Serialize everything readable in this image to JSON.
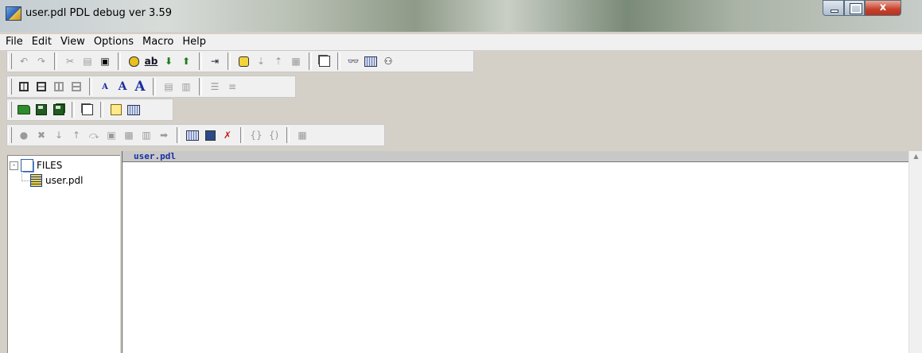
{
  "window": {
    "title": "user.pdl  PDL debug ver 3.59",
    "controls": {
      "close_glyph": "x"
    }
  },
  "menu": [
    "File",
    "Edit",
    "View",
    "Options",
    "Macro",
    "Help"
  ],
  "toolbar_fonts": {
    "small": "A",
    "medium": "A",
    "large": "A"
  },
  "toolbar_glyphs": {
    "ab": "ab",
    "arrow": "➡"
  },
  "tree": {
    "root_label": "FILES",
    "expander": "-",
    "children": [
      "user.pdl"
    ]
  },
  "editor": {
    "tab_title": "user.pdl",
    "scroll_up_glyph": "▲"
  }
}
